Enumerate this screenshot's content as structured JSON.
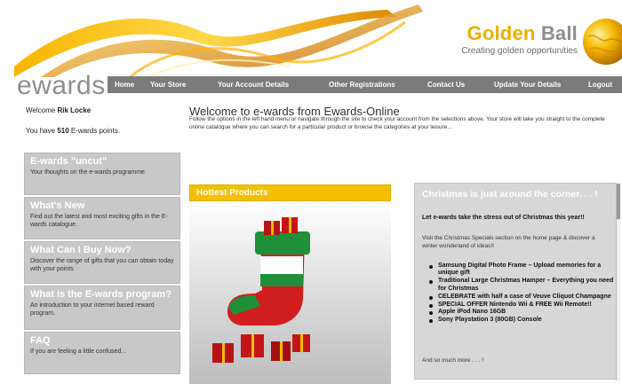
{
  "brand": {
    "name_part1": "Golden",
    "name_part2": "Ball",
    "tagline": "Creating golden opportunities",
    "site_logo": "ewards"
  },
  "nav": {
    "items": [
      {
        "label": "Home"
      },
      {
        "label": "Your Store"
      },
      {
        "label": "Your Account Details"
      },
      {
        "label": "Other Registrations"
      },
      {
        "label": "Contact Us"
      },
      {
        "label": "Update Your Details"
      },
      {
        "label": "Logout"
      }
    ]
  },
  "user": {
    "welcome_prefix": "Welcome",
    "name": "Rik Locke",
    "points_prefix": "You have",
    "points": "510",
    "points_suffix": "E-wards points."
  },
  "sidebar": {
    "items": [
      {
        "title": "E-wards \"uncut\"",
        "desc": "Your thoughts on the e-wards programme"
      },
      {
        "title": "What's New",
        "desc": "Find out the latest and most exciting gifts in the E-wards catalogue."
      },
      {
        "title": "What Can I Buy Now?",
        "desc": "Discover the range of gifts that you can obtain today with your points"
      },
      {
        "title": "What is the E-wards program?",
        "desc": "An introduction to your internet based reward program."
      },
      {
        "title": "FAQ",
        "desc": "If you are feeling a little confused..."
      }
    ]
  },
  "main": {
    "title": "Welcome to e-wards from Ewards-Online",
    "intro": "Follow the options in the left hand menu or navigate through the site to check your account from the selections above.  Your store will take you straight to the complete online catalogue where you can search for a particular product or browse the categories at your leisure..."
  },
  "hottest": {
    "label": "Hottest Products"
  },
  "christmas": {
    "title": "Christmas is just around the corner. . . !",
    "strap": "Let e-wards take the stress out of Christmas this year!!",
    "body": "Visit the Christmas Specials section on the home page & discover a winter wonderland of ideas!!",
    "items": [
      "Samsung Digital Photo Frame – Upload memories for a unique gift",
      "Traditional Large Christmas Hamper – Everything you need for Christmas",
      "CELEBRATE with half a case of Veuve Cliquot Champagne",
      "SPECIAL OFFER Nintendo Wii & FREE Wii Remote!!",
      "Apple iPod Nano 16GB",
      "Sony Playstation 3 (80GB) Console"
    ],
    "more": "And so much more . . . !"
  },
  "colors": {
    "gold": "#f3c000",
    "nav_bg": "#7b7b7b",
    "panel_grey": "#c8c8c8"
  }
}
